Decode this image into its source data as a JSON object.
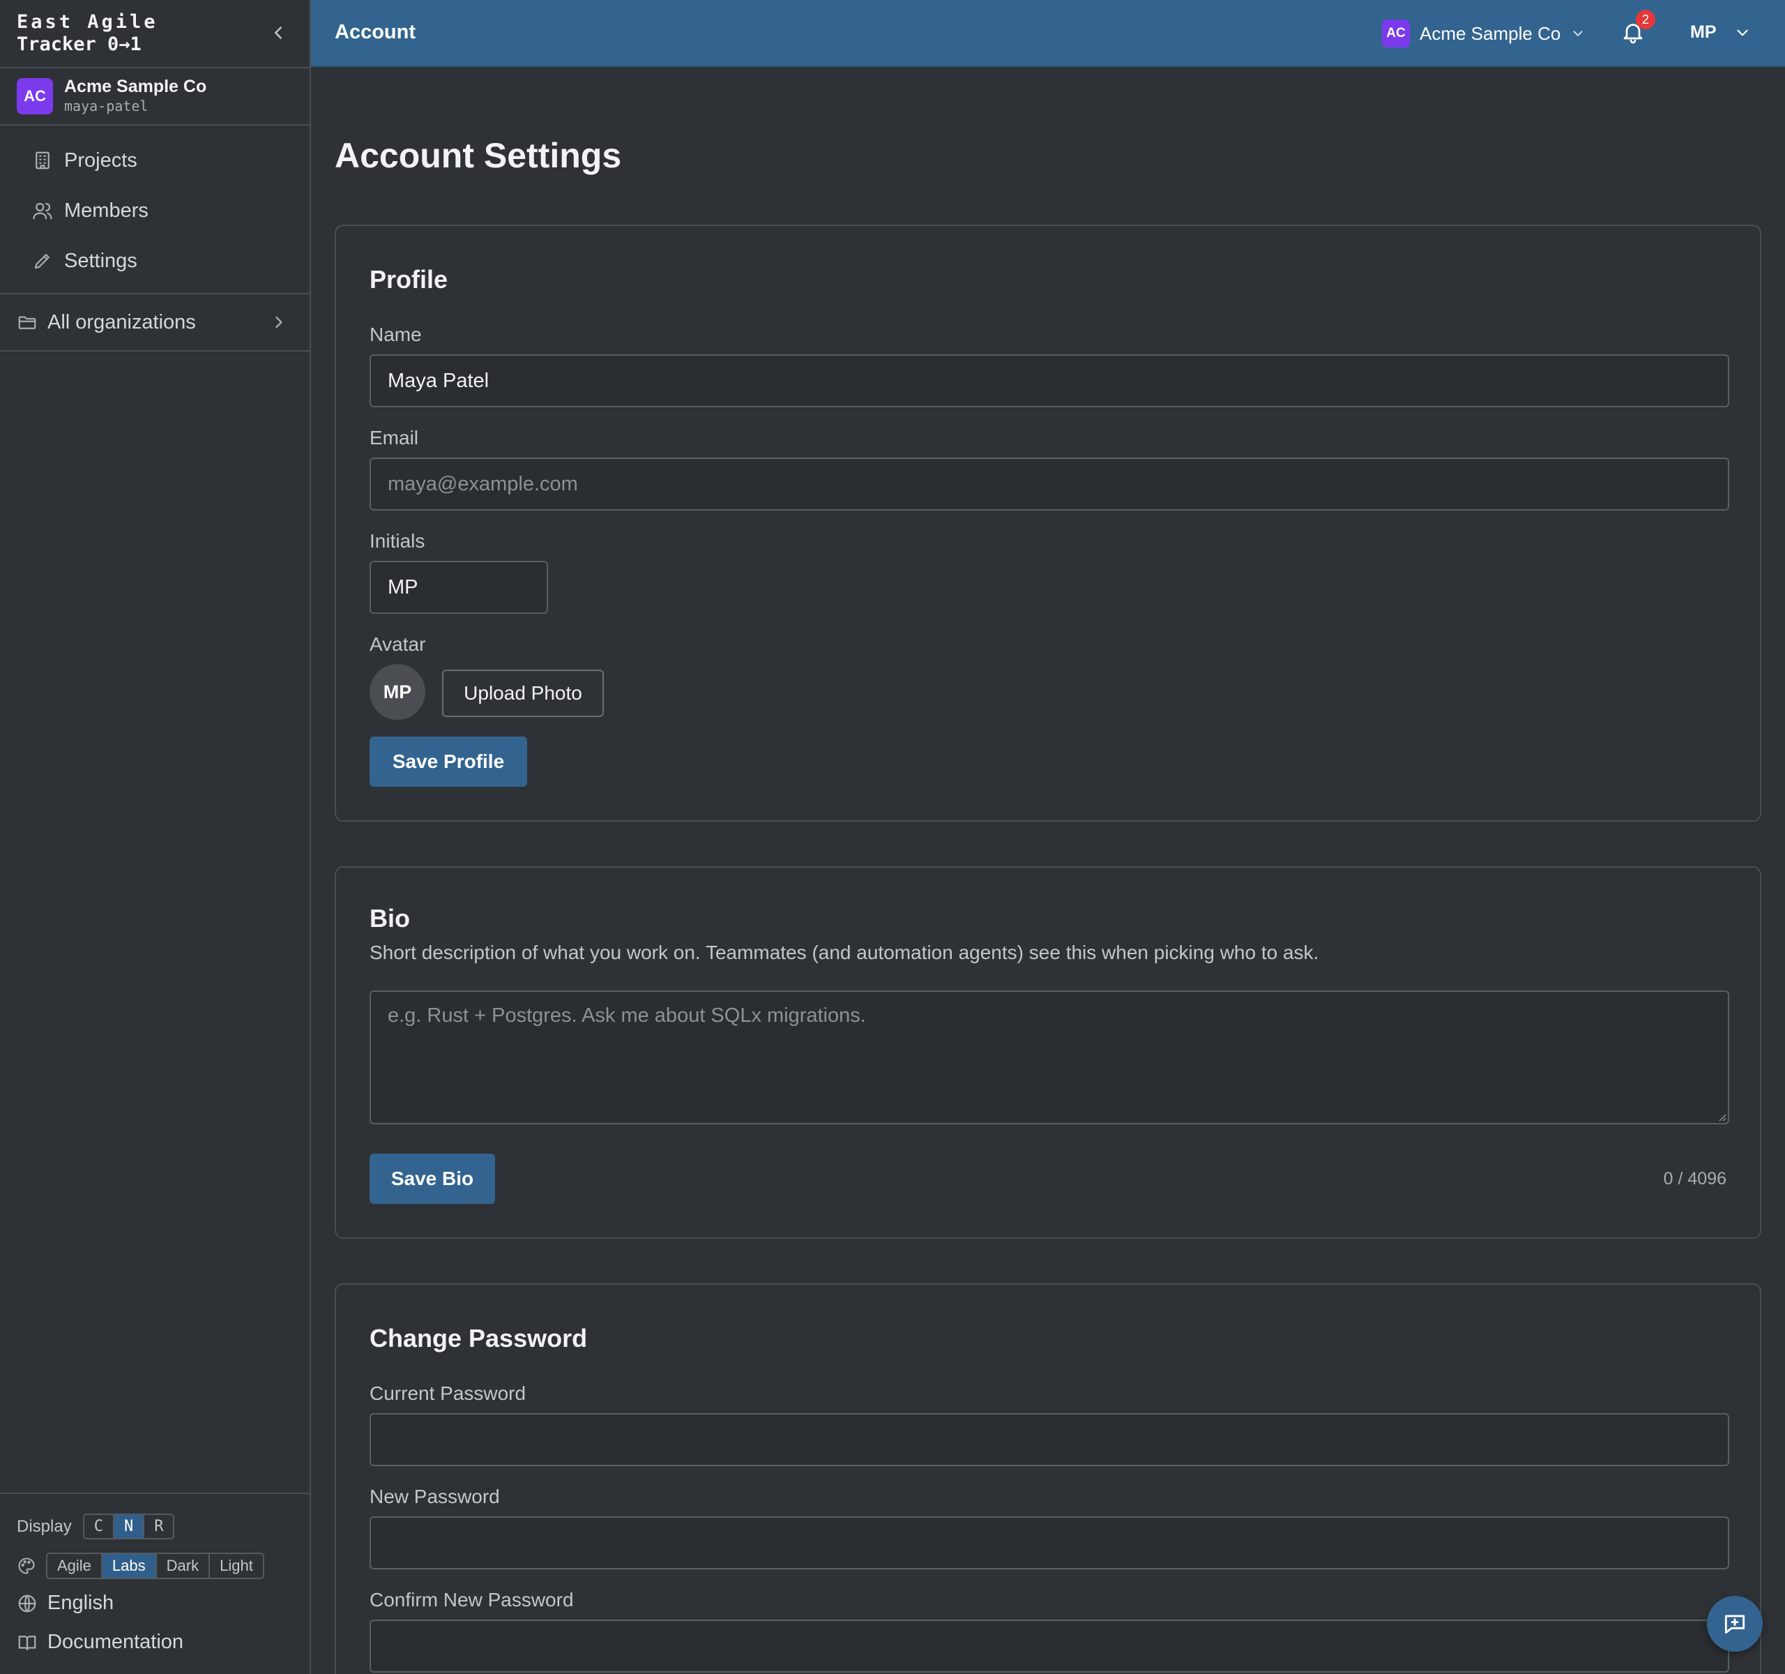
{
  "brand": {
    "line1": "East Agile",
    "line2": "Tracker 0→1"
  },
  "sidebar": {
    "org": {
      "badge": "AC",
      "name": "Acme Sample Co",
      "slug": "maya-patel"
    },
    "nav": [
      {
        "label": "Projects",
        "icon": "building-icon"
      },
      {
        "label": "Members",
        "icon": "users-icon"
      },
      {
        "label": "Settings",
        "icon": "pencil-icon"
      }
    ],
    "all_orgs": "All organizations",
    "footer": {
      "display_label": "Display",
      "density_options": [
        "C",
        "N",
        "R"
      ],
      "density_selected": "N",
      "themes": [
        "Agile",
        "Labs",
        "Dark",
        "Light"
      ],
      "theme_selected": "Labs",
      "language": "English",
      "docs": "Documentation"
    }
  },
  "topbar": {
    "title": "Account",
    "org_badge": "AC",
    "org_name": "Acme Sample Co",
    "notifications": "2",
    "user_initials": "MP"
  },
  "page": {
    "title": "Account Settings",
    "profile": {
      "title": "Profile",
      "name_label": "Name",
      "name_value": "Maya Patel",
      "email_label": "Email",
      "email_placeholder": "maya@example.com",
      "initials_label": "Initials",
      "initials_value": "MP",
      "avatar_label": "Avatar",
      "avatar_initials": "MP",
      "upload_label": "Upload Photo",
      "save_label": "Save Profile"
    },
    "bio": {
      "title": "Bio",
      "description": "Short description of what you work on. Teammates (and automation agents) see this when picking who to ask.",
      "placeholder": "e.g. Rust + Postgres. Ask me about SQLx migrations.",
      "save_label": "Save Bio",
      "counter": "0 / 4096"
    },
    "password": {
      "title": "Change Password",
      "current_label": "Current Password",
      "new_label": "New Password",
      "confirm_label": "Confirm New Password"
    }
  },
  "colors": {
    "accent": "#33648f",
    "org_badge": "#7c3aed",
    "background": "#2e3135",
    "notification": "#e5383b"
  }
}
